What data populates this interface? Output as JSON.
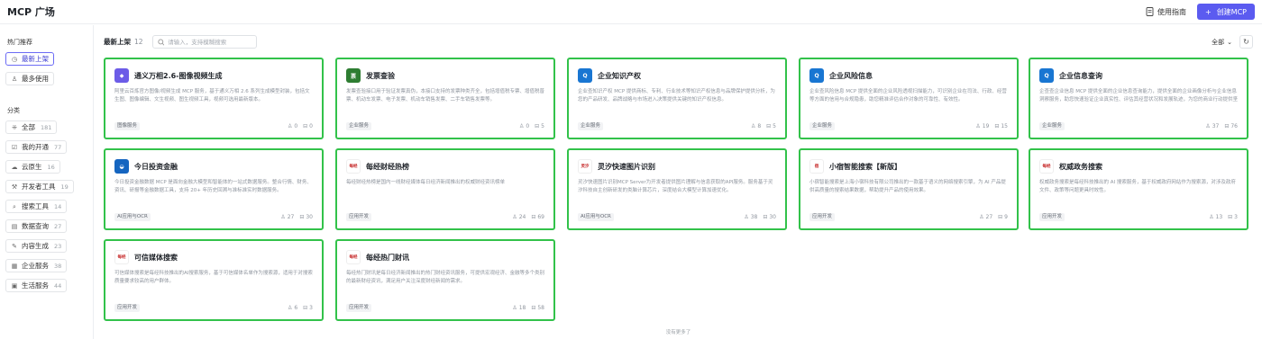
{
  "app": {
    "title": "MCP 广场",
    "guide_label": "使用指南",
    "create_label": "创建MCP",
    "create_plus": "+"
  },
  "sidebar": {
    "hot_heading": "热门推荐",
    "hot_items": [
      {
        "label": "最新上架",
        "icon": "clock-icon",
        "active": true
      },
      {
        "label": "最多使用",
        "icon": "user-icon",
        "active": false
      }
    ],
    "category_heading": "分类",
    "categories": [
      {
        "label": "全部",
        "count": "181",
        "icon": "grid-icon"
      },
      {
        "label": "我的开通",
        "count": "77",
        "icon": "check-box-icon"
      },
      {
        "label": "云原生",
        "count": "16",
        "icon": "cloud-icon"
      },
      {
        "label": "开发者工具",
        "count": "19",
        "icon": "wrench-icon"
      },
      {
        "label": "搜索工具",
        "count": "14",
        "icon": "search-tool-icon"
      },
      {
        "label": "数据查询",
        "count": "27",
        "icon": "database-icon"
      },
      {
        "label": "内容生成",
        "count": "23",
        "icon": "edit-icon"
      },
      {
        "label": "企业服务",
        "count": "38",
        "icon": "building-icon"
      },
      {
        "label": "生活服务",
        "count": "44",
        "icon": "calendar-icon"
      }
    ]
  },
  "toolbar": {
    "title": "最新上架",
    "count": "12",
    "search_placeholder": "请输入，支持模糊搜索",
    "filter_label": "全部",
    "filter_chevron": "⌄"
  },
  "cards": [
    {
      "title": "通义万相2.6-图像视频生成",
      "desc": "阿里云百炼官方图像/视频生成 MCP 服务，基于通义万相 2.6 系列生成模型封装，包括文生图、图像编辑、文生视频、图生视频工具，视频可选用最新版本。",
      "tag": "图像服务",
      "users": "0",
      "calls": "0",
      "logo_color": "#6c5ce7",
      "logo_text": "◆"
    },
    {
      "title": "发票查验",
      "desc": "发票查验接口用于验证发票真伪，本接口支持的发票种类齐全，包括增值税专票、增值税普票、机动车发票、电子发票、机动车销售发票、二手车销售发票等。",
      "tag": "企业服务",
      "users": "0",
      "calls": "5",
      "logo_color": "#2e7d32",
      "logo_text": "票"
    },
    {
      "title": "企业知识产权",
      "desc": "企业查知识产权 MCP 提供商标、专利、行业技术等知识产权信息与品牌保护提供分析，为您的产品研发、品牌战略与市场进入决策提供关键的知识产权信息。",
      "tag": "企业服务",
      "users": "8",
      "calls": "5",
      "logo_color": "#1976d2",
      "logo_text": "Q"
    },
    {
      "title": "企业风险信息",
      "desc": "企业查风险信息 MCP 提供全面的企业风险透视扫描能力，可识别企业在司法、行政、经营等方面的信用与合规隐患，助您精准评估合作对象的可靠性、有效性。",
      "tag": "企业服务",
      "users": "19",
      "calls": "15",
      "logo_color": "#1976d2",
      "logo_text": "Q"
    },
    {
      "title": "企业信息查询",
      "desc": "企查查企业信息 MCP 提供全面的企业信息查询能力，提供全面的企业画像分析与企业信息洞察服务，助您快速验证企业真实性、评估其经营状况和发展轨迹，为您的商业行动提供坚实的数据支持。",
      "tag": "企业服务",
      "users": "37",
      "calls": "76",
      "logo_color": "#1976d2",
      "logo_text": "Q"
    },
    {
      "title": "今日投资金融",
      "desc": "今日投资金融数据 MCP 是面向金融大模型和智能体的一站式数据服务。整合行情、财务、资讯、研报等金融数据工具，支持 20+ 年历史回溯与准标准实时数据服务。",
      "tag": "AI应用与OCR",
      "users": "27",
      "calls": "30",
      "logo_color": "#1565c0",
      "logo_text": "◒"
    },
    {
      "title": "每经财经热榜",
      "desc": "每经财经热榜是国内一线财经媒体每日经济新闻推出的权威财经资讯榜单",
      "tag": "应用开发",
      "users": "24",
      "calls": "69",
      "logo_color": "#ffffff",
      "logo_text": "每经"
    },
    {
      "title": "灵汐快速图片识别",
      "desc": "灵汐快速图片识别MCP Server为开发者提供图片理解与信息获取的API服务。服务基于灵汐科技自主创新研发的类脑计算芯片，深度结合大模型计算加速优化。",
      "tag": "AI应用与OCR",
      "users": "38",
      "calls": "30",
      "logo_color": "#ffffff",
      "logo_text": "灵汐"
    },
    {
      "title": "小宿智能搜索【新版】",
      "desc": "小宿智能搜索是上海小宿科技有限公司推出的一款基于语义的网络搜索引擎，为 AI 产品提供高质量的搜索结果数据，帮助提升产品的使用效果。",
      "tag": "应用开发",
      "users": "27",
      "calls": "9",
      "logo_color": "#ffffff",
      "logo_text": "宿"
    },
    {
      "title": "权威政务搜索",
      "desc": "权威政务搜索是每经科技推出的 AI 搜索服务，基于权威政府网站作为搜索源，对涉及政府文件、政策等问题更具时效性。",
      "tag": "应用开发",
      "users": "13",
      "calls": "3",
      "logo_color": "#ffffff",
      "logo_text": "每经"
    },
    {
      "title": "可信媒体搜索",
      "desc": "可信媒体搜索是每经科技推出的AI搜索服务，基于可信媒体名单作为搜索源，适用于对搜索质量要求较高的用户群体。",
      "tag": "应用开发",
      "users": "6",
      "calls": "3",
      "logo_color": "#ffffff",
      "logo_text": "每经"
    },
    {
      "title": "每经热门财讯",
      "desc": "每经热门财讯是每日经济新闻推出的热门财经资讯服务，可提供宏观经济、金融等多个类别的最新财经资讯，满足用户关注深度财经新闻的需求。",
      "tag": "应用开发",
      "users": "18",
      "calls": "58",
      "logo_color": "#ffffff",
      "logo_text": "每经"
    }
  ],
  "footer": {
    "no_more": "没有更多了"
  },
  "colors": {
    "accent": "#5b5bf0",
    "card_highlight": "#32c24a"
  }
}
